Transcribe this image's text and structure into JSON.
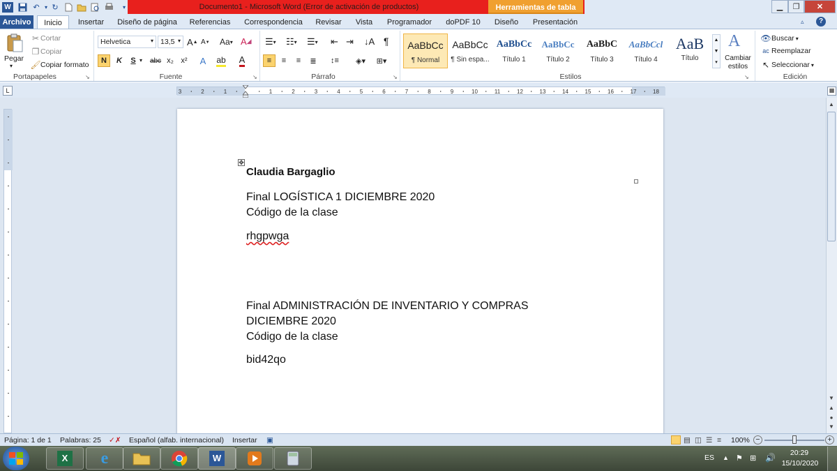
{
  "window": {
    "title": "Documento1  -  Microsoft Word (Error de activación de productos)",
    "context_tab": "Herramientas de tabla",
    "accent_red": "#e8201d",
    "accent_orange": "#f0a030"
  },
  "tabs": [
    "Archivo",
    "Inicio",
    "Insertar",
    "Diseño de página",
    "Referencias",
    "Correspondencia",
    "Revisar",
    "Vista",
    "Programador",
    "doPDF 10",
    "Diseño",
    "Presentación"
  ],
  "ribbon": {
    "clipboard": {
      "paste": "Pegar",
      "cut": "Cortar",
      "copy": "Copiar",
      "format_painter": "Copiar formato",
      "group": "Portapapeles"
    },
    "font": {
      "name": "Helvetica",
      "size": "13,5",
      "group": "Fuente",
      "bold": "N",
      "italic": "K",
      "underline": "S",
      "strike": "abc",
      "subscript": "x₂",
      "superscript": "x²",
      "change_case": "Aa"
    },
    "paragraph": {
      "group": "Párrafo"
    },
    "styles": {
      "group": "Estilos",
      "items": [
        {
          "sample": "AaBbCc",
          "name": "¶ Normal"
        },
        {
          "sample": "AaBbCc",
          "name": "¶ Sin espa..."
        },
        {
          "sample": "AaBbCc",
          "name": "Título 1"
        },
        {
          "sample": "AaBbCc",
          "name": "Título 2"
        },
        {
          "sample": "AaBbC",
          "name": "Título 3"
        },
        {
          "sample": "AaBbCcl",
          "name": "Título 4"
        },
        {
          "sample": "AaB",
          "name": "Título"
        }
      ],
      "change": "Cambiar estilos"
    },
    "editing": {
      "group": "Edición",
      "find": "Buscar",
      "replace": "Reemplazar",
      "select": "Seleccionar"
    }
  },
  "document": {
    "name": "Claudia  Bargaglio",
    "block1_title": "Final LOGÍSTICA 1 DICIEMBRE 2020",
    "block1_label": "Código de la clase",
    "block1_code": "rhgpwga",
    "block2_title_line1": "Final ADMINISTRACIÓN DE INVENTARIO Y COMPRAS",
    "block2_title_line2": "DICIEMBRE 2020",
    "block2_label": "Código de la clase",
    "block2_code": "bid42qo"
  },
  "status": {
    "page": "Página: 1 de 1",
    "words": "Palabras: 25",
    "language": "Español (alfab. internacional)",
    "mode": "Insertar",
    "zoom": "100%",
    "zoom_fraction": 0.5
  },
  "taskbar": {
    "lang": "ES",
    "time": "20:29",
    "date": "15/10/2020"
  }
}
